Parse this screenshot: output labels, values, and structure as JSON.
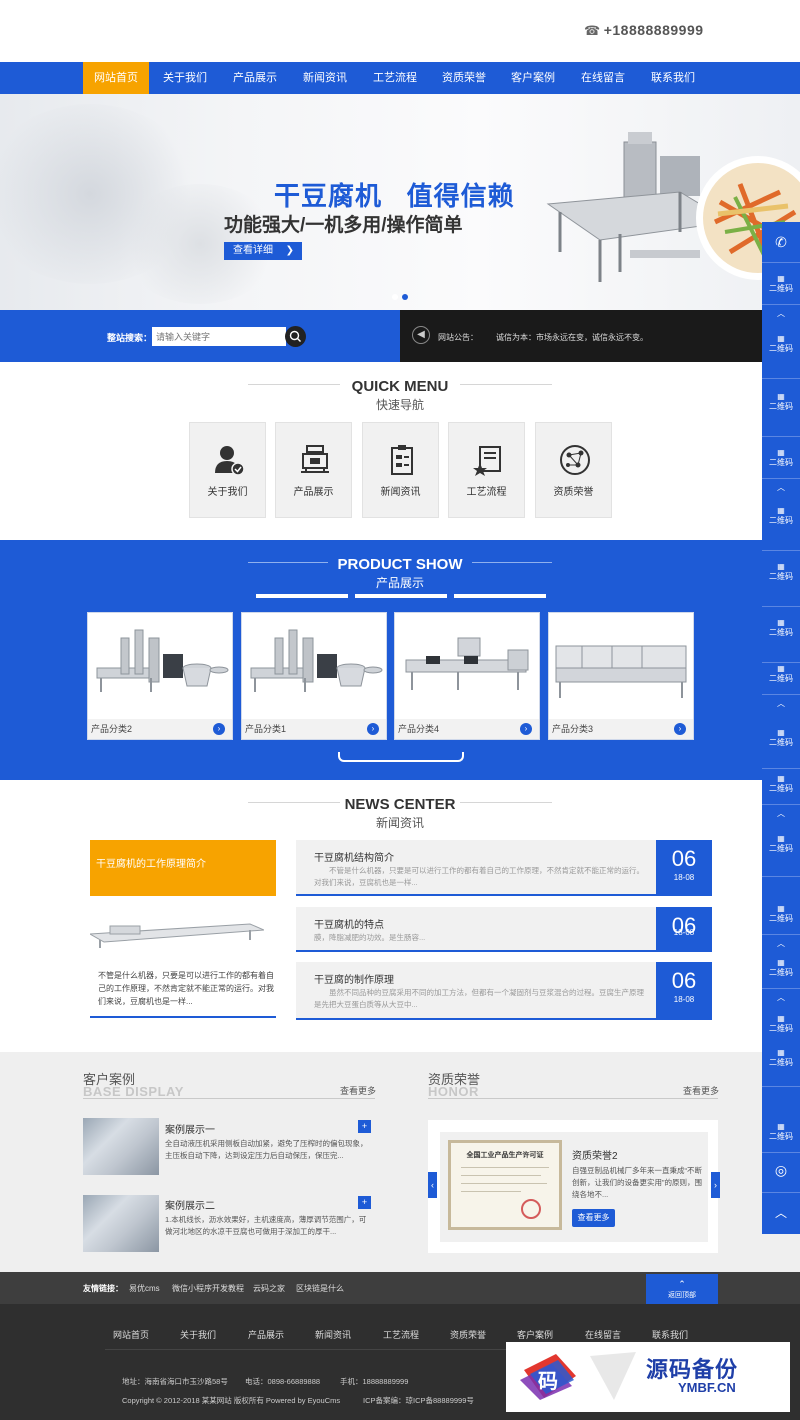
{
  "header": {
    "phone": "+18888889999",
    "phone_icon": "phone-icon"
  },
  "nav": {
    "items": [
      "网站首页",
      "关于我们",
      "产品展示",
      "新闻资讯",
      "工艺流程",
      "资质荣誉",
      "客户案例",
      "在线留言",
      "联系我们"
    ],
    "active_index": 0,
    "colors": {
      "nav_bg": "#1e5bd6",
      "active_bg": "#f7a300"
    }
  },
  "banner": {
    "title": "干豆腐机   值得信赖",
    "subtitle": "功能强大/一机多用/操作简单",
    "button": "查看详细",
    "slides": 2,
    "active_slide": 1
  },
  "search": {
    "label": "整站搜索：",
    "placeholder": "请输入关键字",
    "button_icon": "search-icon"
  },
  "notice": {
    "label": "网站公告：",
    "text": "诚信为本：市场永远在变，诚信永远不变。",
    "icon": "speaker-icon"
  },
  "quick_menu": {
    "en": "QUICK MENU",
    "cn": "快速导航",
    "items": [
      {
        "label": "关于我们",
        "icon": "user-check-icon"
      },
      {
        "label": "产品展示",
        "icon": "machine-icon"
      },
      {
        "label": "新闻资讯",
        "icon": "clipboard-icon"
      },
      {
        "label": "工艺流程",
        "icon": "book-star-icon"
      },
      {
        "label": "资质荣誉",
        "icon": "network-globe-icon"
      }
    ]
  },
  "products": {
    "en": "PRODUCT SHOW",
    "cn": "产品展示",
    "items": [
      {
        "label": "产品分类2"
      },
      {
        "label": "产品分类1"
      },
      {
        "label": "产品分类4"
      },
      {
        "label": "产品分类3"
      }
    ]
  },
  "news": {
    "en": "NEWS CENTER",
    "cn": "新闻资讯",
    "featured": {
      "title": "干豆腐机的工作原理简介",
      "text": "不管是什么机器，只要是可以进行工作的都有着自己的工作原理，不然肯定就不能正常的运行。对我们来说，豆腐机也是一样..."
    },
    "items": [
      {
        "title": "干豆腐机结构简介",
        "desc": "不管是什么机器，只要是可以进行工作的都有着自己的工作原理，不然肯定就不能正常的运行。对我们来说，豆腐机也是一样...",
        "day": "06",
        "date": "18-08"
      },
      {
        "title": "干豆腐机的特点",
        "desc": "膜，降脂减肥的功效。是生肠容...",
        "day": "06",
        "date": "18-08"
      },
      {
        "title": "干豆腐的制作原理",
        "desc": "虽然不同品种的豆腐采用不同的加工方法，但都有一个凝固剂与豆浆混合的过程。豆腐生产原理是先把大豆蛋白质等从大豆中...",
        "day": "06",
        "date": "18-08"
      }
    ]
  },
  "cases": {
    "title": "客户案例",
    "en": "BASE DISPLAY",
    "more": "查看更多",
    "items": [
      {
        "title": "案例展示一",
        "desc": "全自动液压机采用侧板自动加紧，避免了压榨时的偏包现象，主压板自动下降，达到设定压力后自动保压，保压完..."
      },
      {
        "title": "案例展示二",
        "desc": "1.本机线长，沥水效果好，主机速度高，薄厚调节范围广，可做河北地区的水凉干豆腐也可做用于深加工的厚干..."
      }
    ]
  },
  "honor": {
    "title": "资质荣誉",
    "en": "HONOR",
    "more": "查看更多",
    "item_title": "资质荣誉2",
    "item_desc": "自强豆制品机械厂多年来一直秉成“不断创新，让我们的设备更实用”的原则，围绕各地不...",
    "button": "查看更多",
    "cert_title": "全国工业产品生产许可证"
  },
  "links": {
    "label": "友情链接：",
    "items": [
      "易优cms",
      "微信小程序开发教程",
      "云码之家",
      "区块链是什么"
    ],
    "to_top": "返回顶部"
  },
  "footer": {
    "nav": [
      "网站首页",
      "关于我们",
      "产品展示",
      "新闻资讯",
      "工艺流程",
      "资质荣誉",
      "客户案例",
      "在线留言",
      "联系我们"
    ],
    "address": "地址：海南省海口市玉沙路58号",
    "tel": "电话：0898-66889888",
    "mobile": "手机：18888889999",
    "copyright": "Copyright © 2012-2018 某某网站 版权所有 Powered by EyouCms",
    "icp": "ICP备案编：琼ICP备88889999号"
  },
  "sidebar": {
    "qr_label": "二维码",
    "icons": [
      "phone-icon",
      "qr-icon",
      "up-icon",
      "qq-icon"
    ]
  },
  "watermark": {
    "cn": "源码备份",
    "en": "YMBF.CN",
    "mark_char": "码"
  }
}
